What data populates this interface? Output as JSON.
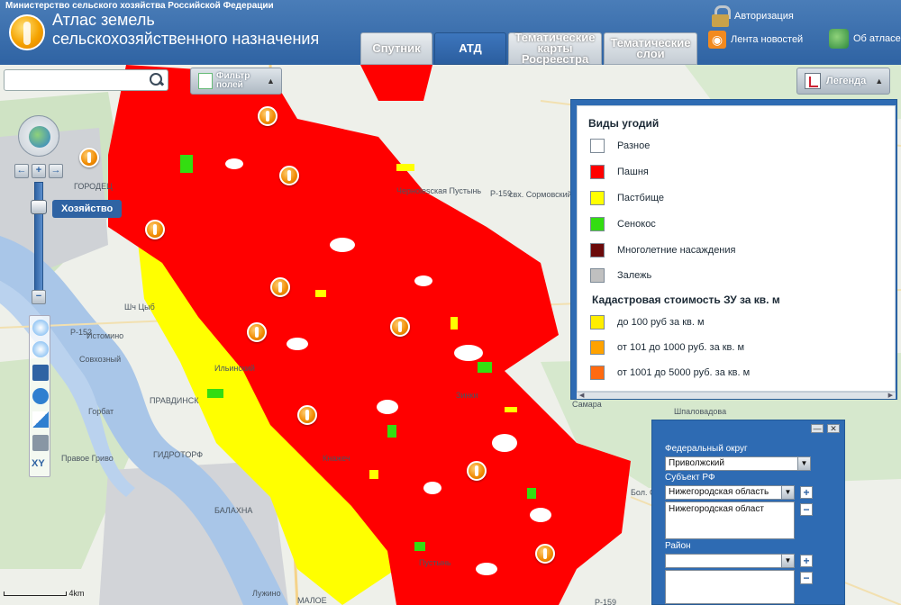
{
  "header": {
    "ministry": "Министерство сельского хозяйства Российской Федерации",
    "title_line1": "Атлас земель",
    "title_line2": "сельскохозяйственного назначения",
    "tabs": [
      {
        "label": "Спутник",
        "active": false
      },
      {
        "label": "АТД",
        "active": true
      },
      {
        "label": "Тематические карты Росреестра",
        "active": false
      },
      {
        "label": "Тематические слои",
        "active": false
      }
    ],
    "auth_label": "Авторизация",
    "news_label": "Лента новостей",
    "about_label": "Об атласе"
  },
  "toolbar": {
    "search_placeholder": "",
    "filter_label": "Фильтр полей",
    "legend_label": "Легенда",
    "zoom_tooltip": "Хозяйство",
    "xy_label": "XY"
  },
  "legend": {
    "section1_title": "Виды угодий",
    "section1_items": [
      {
        "label": "Разное",
        "color": "#ffffff"
      },
      {
        "label": "Пашня",
        "color": "#ff0000"
      },
      {
        "label": "Пастбище",
        "color": "#ffff00"
      },
      {
        "label": "Сенокос",
        "color": "#33dd11"
      },
      {
        "label": "Многолетние насаждения",
        "color": "#6b0a0a"
      },
      {
        "label": "Залежь",
        "color": "#c0c0c0"
      }
    ],
    "section2_title": "Кадастровая стоимость ЗУ за кв. м",
    "section2_items": [
      {
        "label": "до 100 руб за кв. м",
        "color": "#ffee00"
      },
      {
        "label": "от 101 до 1000 руб. за кв. м",
        "color": "#ffa200"
      },
      {
        "label": "от 1001 до 5000 руб. за кв. м",
        "color": "#ff6a10"
      }
    ]
  },
  "admin_panel": {
    "federal_district_label": "Федеральный округ",
    "federal_district_value": "Приволжский",
    "subject_label": "Субъект РФ",
    "subject_value": "Нижегородская область",
    "subject_list": [
      "Нижегородская област"
    ],
    "district_label": "Район",
    "district_value": ""
  },
  "map": {
    "places": [
      "ГОРОДЕЦ",
      "Черноlesская Пустынь",
      "свх. Сормовский",
      "Шпаловадова",
      "Зинки",
      "ПРАВДИНСК",
      "ГИДРОТОРФ",
      "БАЛАХНА",
      "Истомино",
      "Совхозный",
      "Шч Цыб",
      "Ильинский",
      "Кнажеч",
      "Лужино",
      "МАЛОЕ",
      "Бол. Ост",
      "Пустынь",
      "Самара",
      "Р-152",
      "Р-159",
      "Р-159",
      "Горбат",
      "Правое Гриво",
      "Ж"
    ],
    "scale_label": "4km",
    "colors": {
      "arable": "#ff0000",
      "pasture": "#ffff00",
      "hay": "#33dd11"
    }
  }
}
